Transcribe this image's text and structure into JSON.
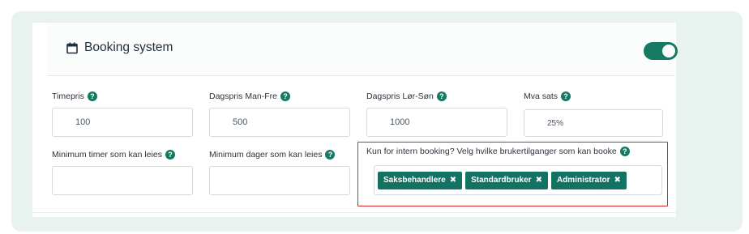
{
  "panel": {
    "title": "Booking system",
    "toggle_on": true
  },
  "fields": {
    "timepris": {
      "label": "Timepris",
      "value": "100"
    },
    "dagspris_man_fre": {
      "label": "Dagspris Man-Fre",
      "value": "500"
    },
    "dagspris_lor_son": {
      "label": "Dagspris Lør-Søn",
      "value": "1000"
    },
    "mva_sats": {
      "label": "Mva sats",
      "value": "25%"
    },
    "min_timer": {
      "label": "Minimum timer som kan leies",
      "value": ""
    },
    "min_dager": {
      "label": "Minimum dager som kan leies",
      "value": ""
    },
    "intern_booking": {
      "label": "Kun for intern booking? Velg hvilke brukertilganger som kan booke",
      "chips": [
        "Saksbehandlere",
        "Standardbruker",
        "Administrator"
      ]
    }
  },
  "help_glyph": "?",
  "remove_glyph": "✖",
  "colors": {
    "accent": "#157a63",
    "highlight": "#d9272e",
    "background": "#e8f2ef"
  }
}
